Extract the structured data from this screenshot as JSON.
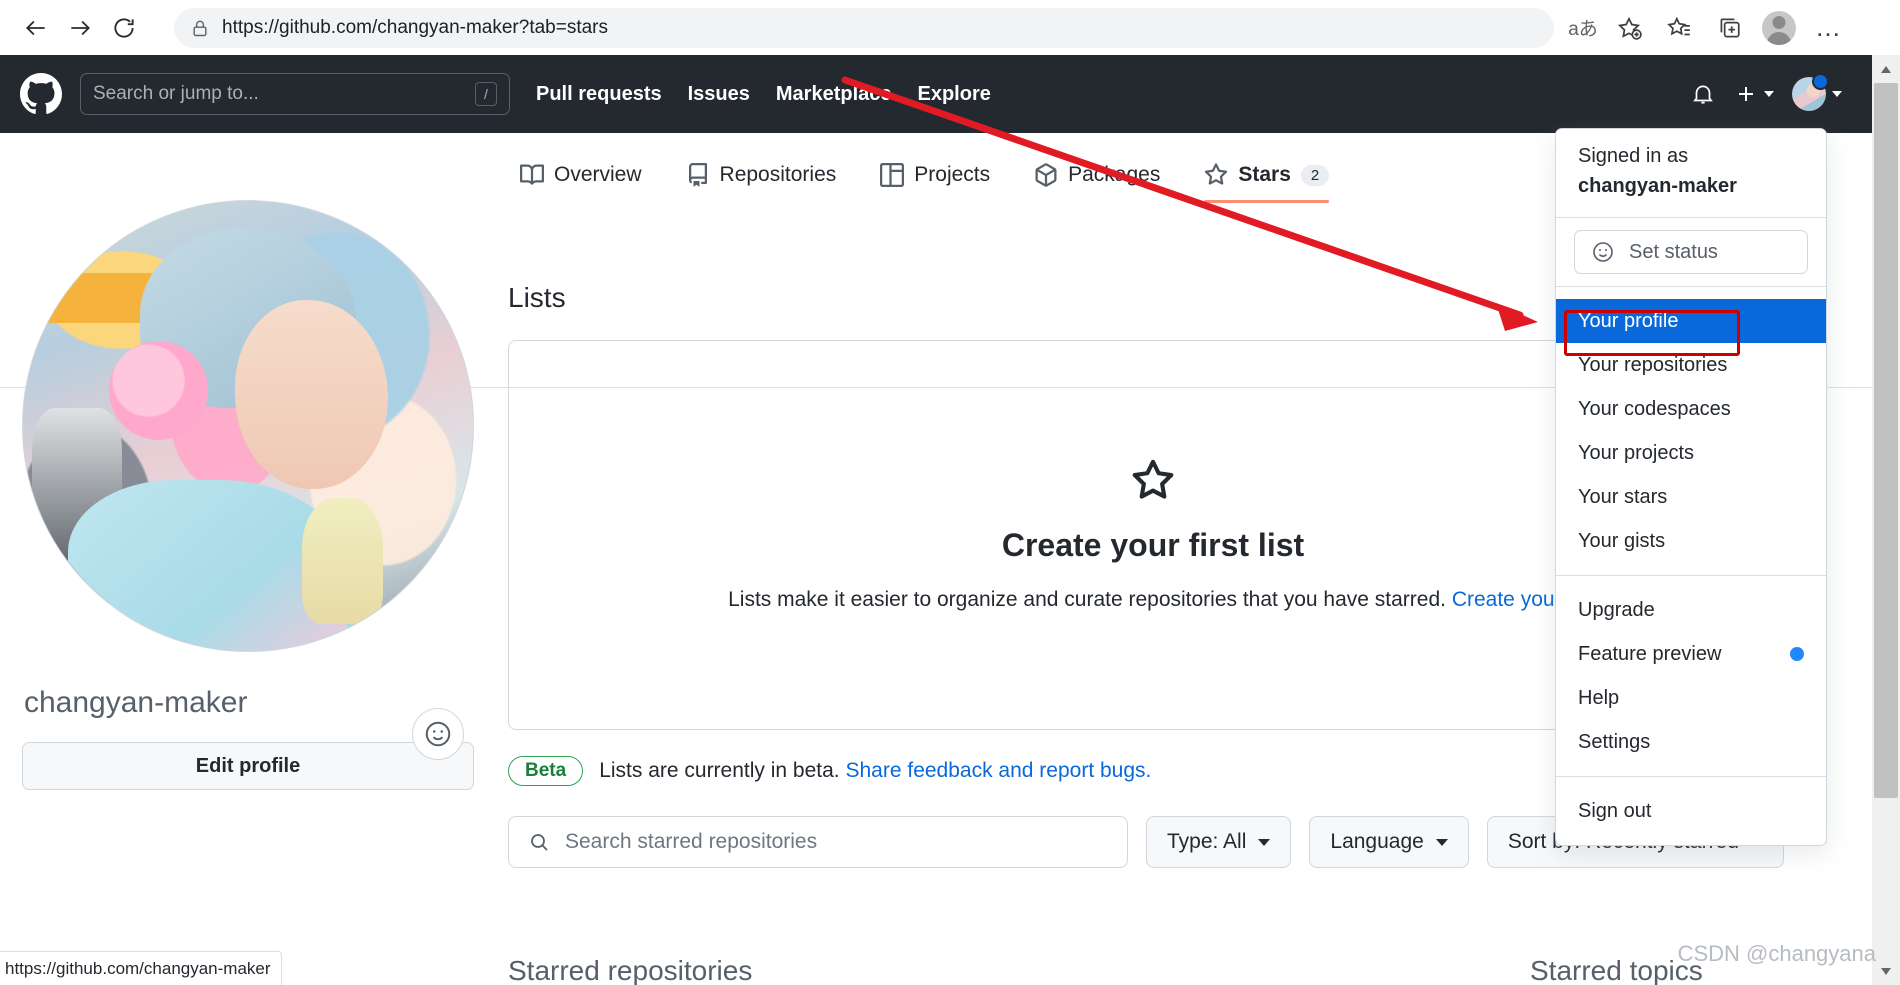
{
  "browser": {
    "back_icon": "arrow-left-icon",
    "forward_icon": "arrow-right-icon",
    "reload_icon": "reload-icon",
    "lock_icon": "lock-icon",
    "url_prefix": "https://github.com/",
    "url_path": "changyan-maker?tab=stars",
    "url_full": "https://github.com/changyan-maker?tab=stars",
    "actions": [
      {
        "name": "read-aloud-icon",
        "glyph": "aあ"
      },
      {
        "name": "add-favorite-icon",
        "glyph": "star-plus"
      },
      {
        "name": "favorites-icon",
        "glyph": "star-list"
      },
      {
        "name": "collections-icon",
        "glyph": "collections"
      },
      {
        "name": "profile-icon",
        "glyph": "avatar"
      },
      {
        "name": "settings-more-icon",
        "glyph": "…"
      }
    ]
  },
  "gh_header": {
    "logo": "github-logo",
    "search_placeholder": "Search or jump to...",
    "search_shortcut": "/",
    "nav": [
      {
        "label": "Pull requests"
      },
      {
        "label": "Issues"
      },
      {
        "label": "Marketplace"
      },
      {
        "label": "Explore"
      }
    ],
    "notifications_icon": "bell-icon",
    "create_new_icon": "plus-icon",
    "account_icon": "account-avatar"
  },
  "profile_nav": {
    "tabs": [
      {
        "label": "Overview",
        "icon": "book-icon",
        "count": "",
        "active": false
      },
      {
        "label": "Repositories",
        "icon": "repo-icon",
        "count": "",
        "active": false
      },
      {
        "label": "Projects",
        "icon": "project-icon",
        "count": "",
        "active": false
      },
      {
        "label": "Packages",
        "icon": "package-icon",
        "count": "",
        "active": false
      },
      {
        "label": "Stars",
        "icon": "star-icon",
        "count": "2",
        "active": true
      }
    ]
  },
  "profile": {
    "avatar": "user-avatar-photo",
    "set_status_icon": "smiley-icon",
    "login": "changyan-maker",
    "edit_button": "Edit profile"
  },
  "main": {
    "lists_title": "Lists",
    "empty": {
      "icon": "star-outline-icon",
      "heading": "Create your first list",
      "description": "Lists make it easier to organize and curate repositories that you have starred.",
      "link": "Create your fi"
    },
    "beta": {
      "badge": "Beta",
      "text": "Lists are currently in beta.",
      "link": "Share feedback and report bugs."
    },
    "filters": {
      "search_placeholder": "Search starred repositories",
      "search_icon": "search-icon",
      "type": "Type: All",
      "language": "Language",
      "sort": "Sort by: Recently starred"
    },
    "section_left": "Starred repositories",
    "section_right": "Starred topics"
  },
  "dropdown": {
    "signed_in_label": "Signed in as",
    "username": "changyan-maker",
    "set_status": "Set status",
    "set_status_icon": "smiley-icon",
    "items_primary": [
      {
        "label": "Your profile",
        "selected": true,
        "dot": false
      },
      {
        "label": "Your repositories",
        "selected": false,
        "dot": false
      },
      {
        "label": "Your codespaces",
        "selected": false,
        "dot": false
      },
      {
        "label": "Your projects",
        "selected": false,
        "dot": false
      },
      {
        "label": "Your stars",
        "selected": false,
        "dot": false
      },
      {
        "label": "Your gists",
        "selected": false,
        "dot": false
      }
    ],
    "items_secondary": [
      {
        "label": "Upgrade",
        "selected": false,
        "dot": false
      },
      {
        "label": "Feature preview",
        "selected": false,
        "dot": true
      },
      {
        "label": "Help",
        "selected": false,
        "dot": false
      },
      {
        "label": "Settings",
        "selected": false,
        "dot": false
      }
    ],
    "items_tertiary": [
      {
        "label": "Sign out",
        "selected": false,
        "dot": false
      }
    ]
  },
  "annotations": {
    "arrow_color": "#e01b24",
    "highlight_color": "#c00000"
  },
  "statusbar": {
    "link_preview": "https://github.com/changyan-maker"
  },
  "watermark": {
    "text": "CSDN @changyana"
  },
  "colors": {
    "gh_header_bg": "#24292f",
    "accent_blue": "#0969da",
    "underline_orange": "#fd8c73",
    "beta_green": "#1a7f37"
  }
}
